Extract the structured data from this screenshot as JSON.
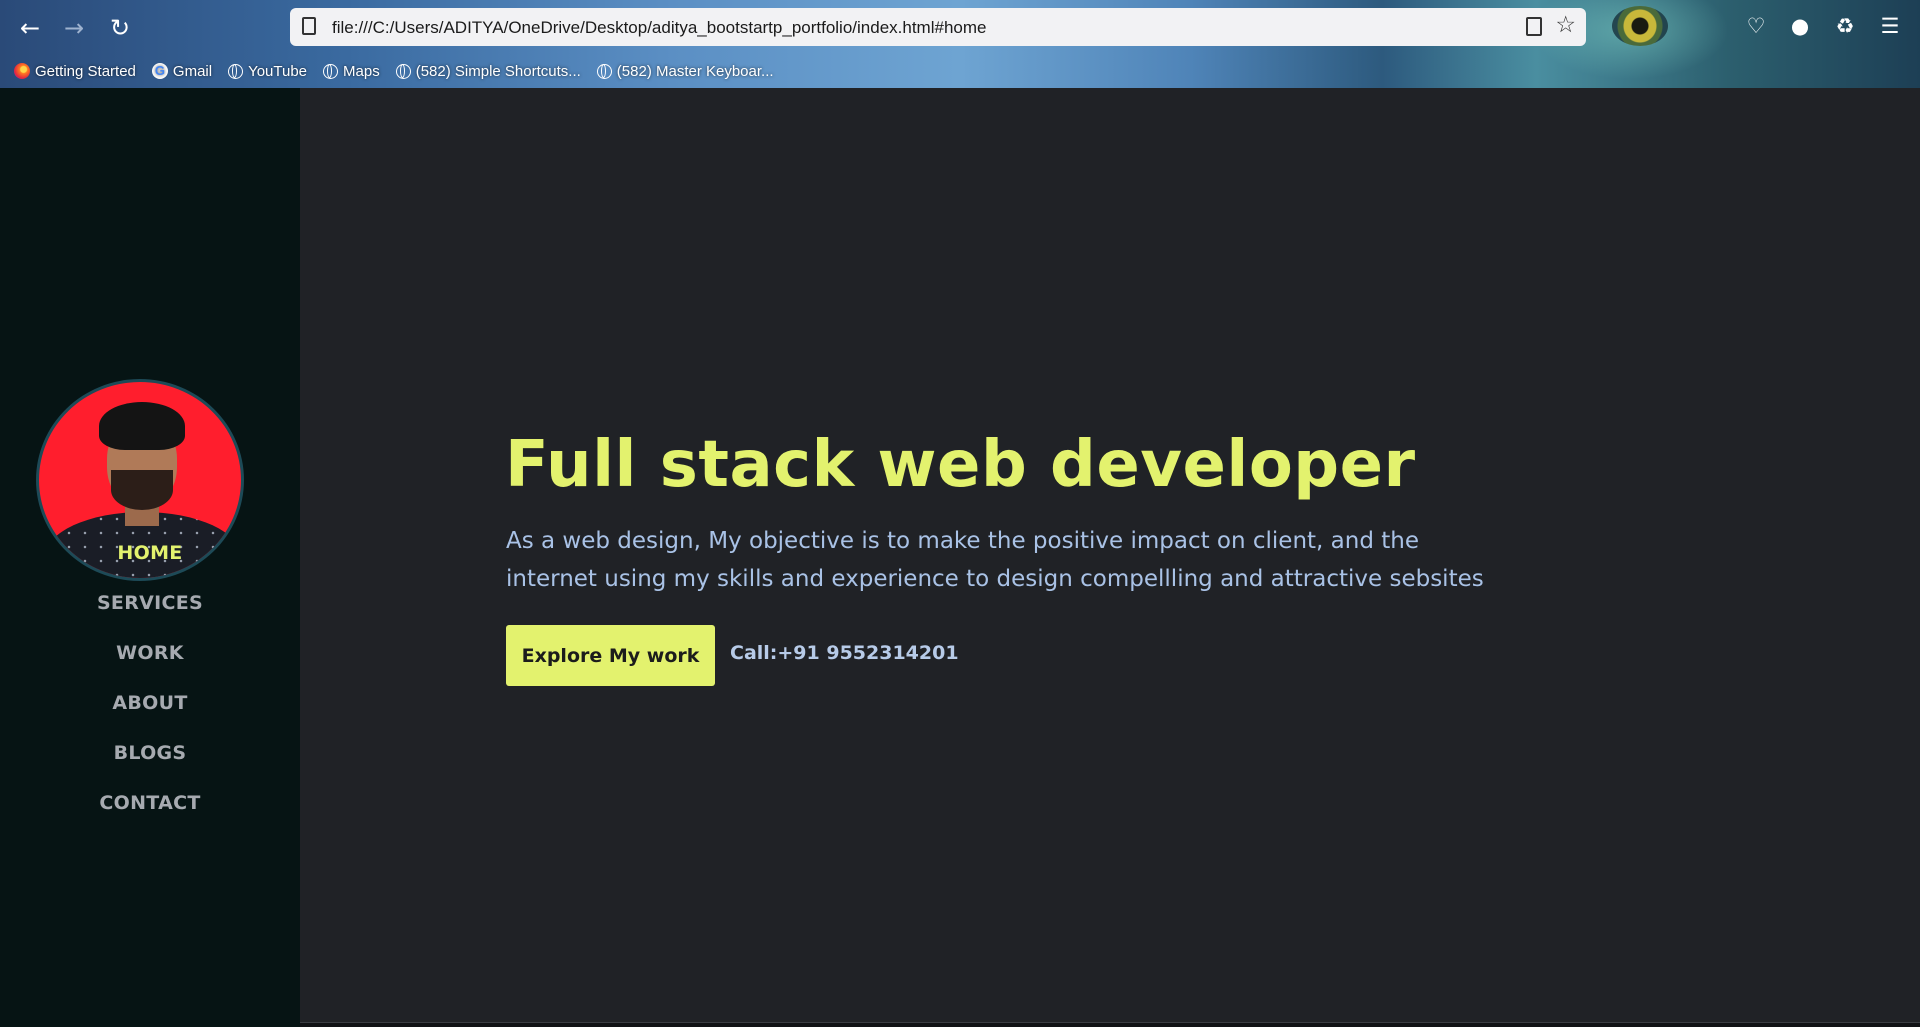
{
  "browser": {
    "url": "file:///C:/Users/ADITYA/OneDrive/Desktop/aditya_bootstartp_portfolio/index.html#home",
    "bookmarks": [
      {
        "label": "Getting Started",
        "icon": "firefox-icon"
      },
      {
        "label": "Gmail",
        "icon": "google-icon"
      },
      {
        "label": "YouTube",
        "icon": "globe-icon"
      },
      {
        "label": "Maps",
        "icon": "globe-icon"
      },
      {
        "label": "(582) Simple Shortcuts...",
        "icon": "globe-icon"
      },
      {
        "label": "(582) Master Keyboar...",
        "icon": "globe-icon"
      }
    ]
  },
  "sidebar": {
    "items": [
      {
        "label": "HOME",
        "active": true
      },
      {
        "label": "SERVICES"
      },
      {
        "label": "WORK"
      },
      {
        "label": "ABOUT"
      },
      {
        "label": "BLOGS"
      },
      {
        "label": "CONTACT"
      }
    ]
  },
  "hero": {
    "title": "Full stack web developer",
    "text": "As a web design, My objective is to make the positive impact on client, and the internet using my skills and experience to design compellling and attractive sebsites",
    "button": "Explore My work",
    "call": "Call:+91 9552314201"
  },
  "colors": {
    "accent": "#e3f26e",
    "sidebar_bg": "#061414",
    "main_bg": "#202226",
    "text": "#a9c2e6"
  }
}
